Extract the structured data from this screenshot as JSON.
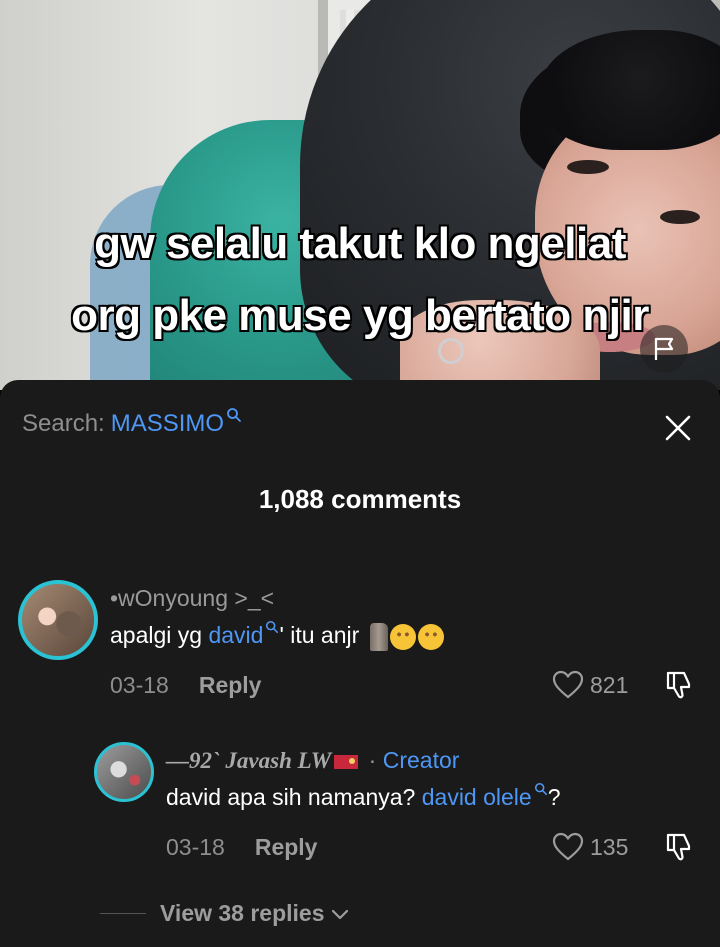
{
  "video": {
    "caption_line1": "gw selalu takut klo ngeliat",
    "caption_line2": "org pke muse yg bertato njir"
  },
  "sheet": {
    "search_prefix": "Search:",
    "search_term": "MASSIMO",
    "comment_count": "1,088 comments"
  },
  "comments": [
    {
      "username": "•wOnyoung  >_<",
      "text_before": "apalgi yg ",
      "link": "david",
      "text_after": "' itu anjr",
      "date": "03-18",
      "reply_label": "Reply",
      "likes": "821"
    },
    {
      "username": "—92` Javash LW",
      "separator": " · ",
      "creator_label": "Creator",
      "text_before": "david apa sih namanya? ",
      "link": "david olele",
      "text_after": "?",
      "date": "03-18",
      "reply_label": "Reply",
      "likes": "135"
    }
  ],
  "view_replies": "View 38 replies",
  "colors": {
    "accent_blue": "#4e97f5",
    "avatar_ring": "#2bc2d3",
    "sheet_bg": "#1a1a1a"
  },
  "icons": [
    "flag-icon",
    "search-icon",
    "close-icon",
    "heart-icon",
    "dislike-icon",
    "chevron-down-icon"
  ]
}
